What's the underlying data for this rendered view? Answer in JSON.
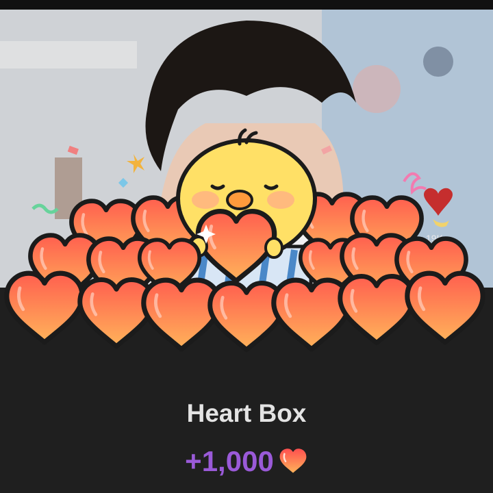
{
  "gift": {
    "title": "Heart Box",
    "amount": "+1,000",
    "currency_icon": "heart-icon"
  },
  "background": {
    "side_count": "19K"
  },
  "colors": {
    "panel": "#1f1f1f",
    "title": "#e3e3e3",
    "amount": "#9a5ad8",
    "heart_top": "#ff6b4a",
    "heart_bottom": "#ffb54d",
    "chick": "#ffe066"
  }
}
